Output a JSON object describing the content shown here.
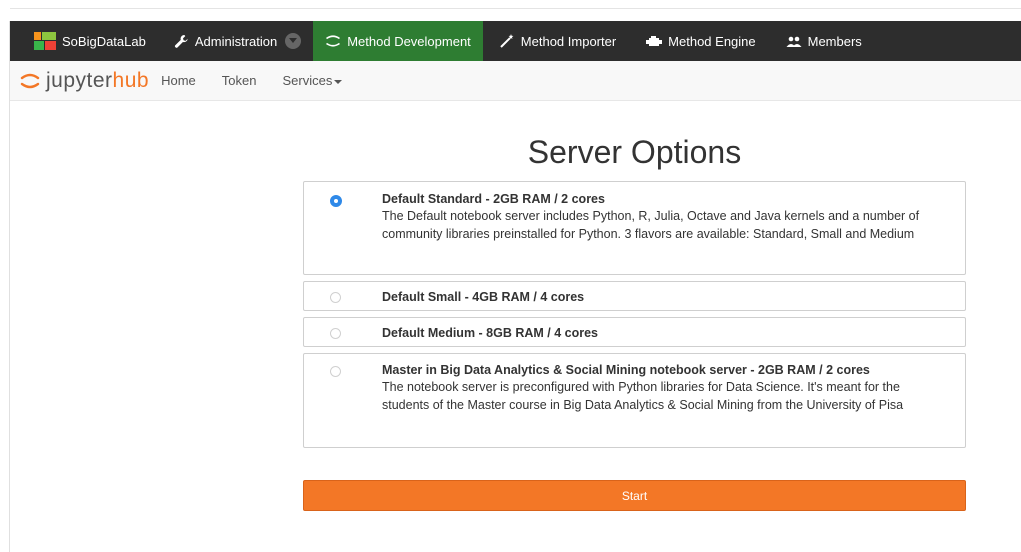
{
  "navbar": {
    "brand": "SoBigDataLab",
    "items": [
      {
        "label": "Administration"
      },
      {
        "label": "Method Development"
      },
      {
        "label": "Method Importer"
      },
      {
        "label": "Method Engine"
      },
      {
        "label": "Members"
      }
    ]
  },
  "jupyterhub": {
    "logo_part1": "jupyter",
    "logo_part2": "hub",
    "links": {
      "home": "Home",
      "token": "Token",
      "services": "Services"
    }
  },
  "page": {
    "title": "Server Options",
    "options": [
      {
        "title": "Default Standard - 2GB RAM / 2 cores",
        "description": "The Default notebook server includes Python, R, Julia, Octave and Java kernels and a number of community libraries preinstalled for Python. 3 flavors are available: Standard, Small and Medium",
        "selected": true
      },
      {
        "title": "Default Small - 4GB RAM / 4 cores",
        "description": "",
        "selected": false
      },
      {
        "title": "Default Medium - 8GB RAM / 4 cores",
        "description": "",
        "selected": false
      },
      {
        "title": "Master in Big Data Analytics & Social Mining notebook server - 2GB RAM / 2 cores",
        "description": "The notebook server is preconfigured with Python libraries for Data Science. It's meant for the students of the Master course in Big Data Analytics & Social Mining from the University of Pisa",
        "selected": false
      }
    ],
    "start_label": "Start"
  },
  "colors": {
    "navbar_bg": "#2d2d2d",
    "active_tab": "#2e7d32",
    "accent_orange": "#f37726",
    "radio_selected": "#2f89e8"
  }
}
